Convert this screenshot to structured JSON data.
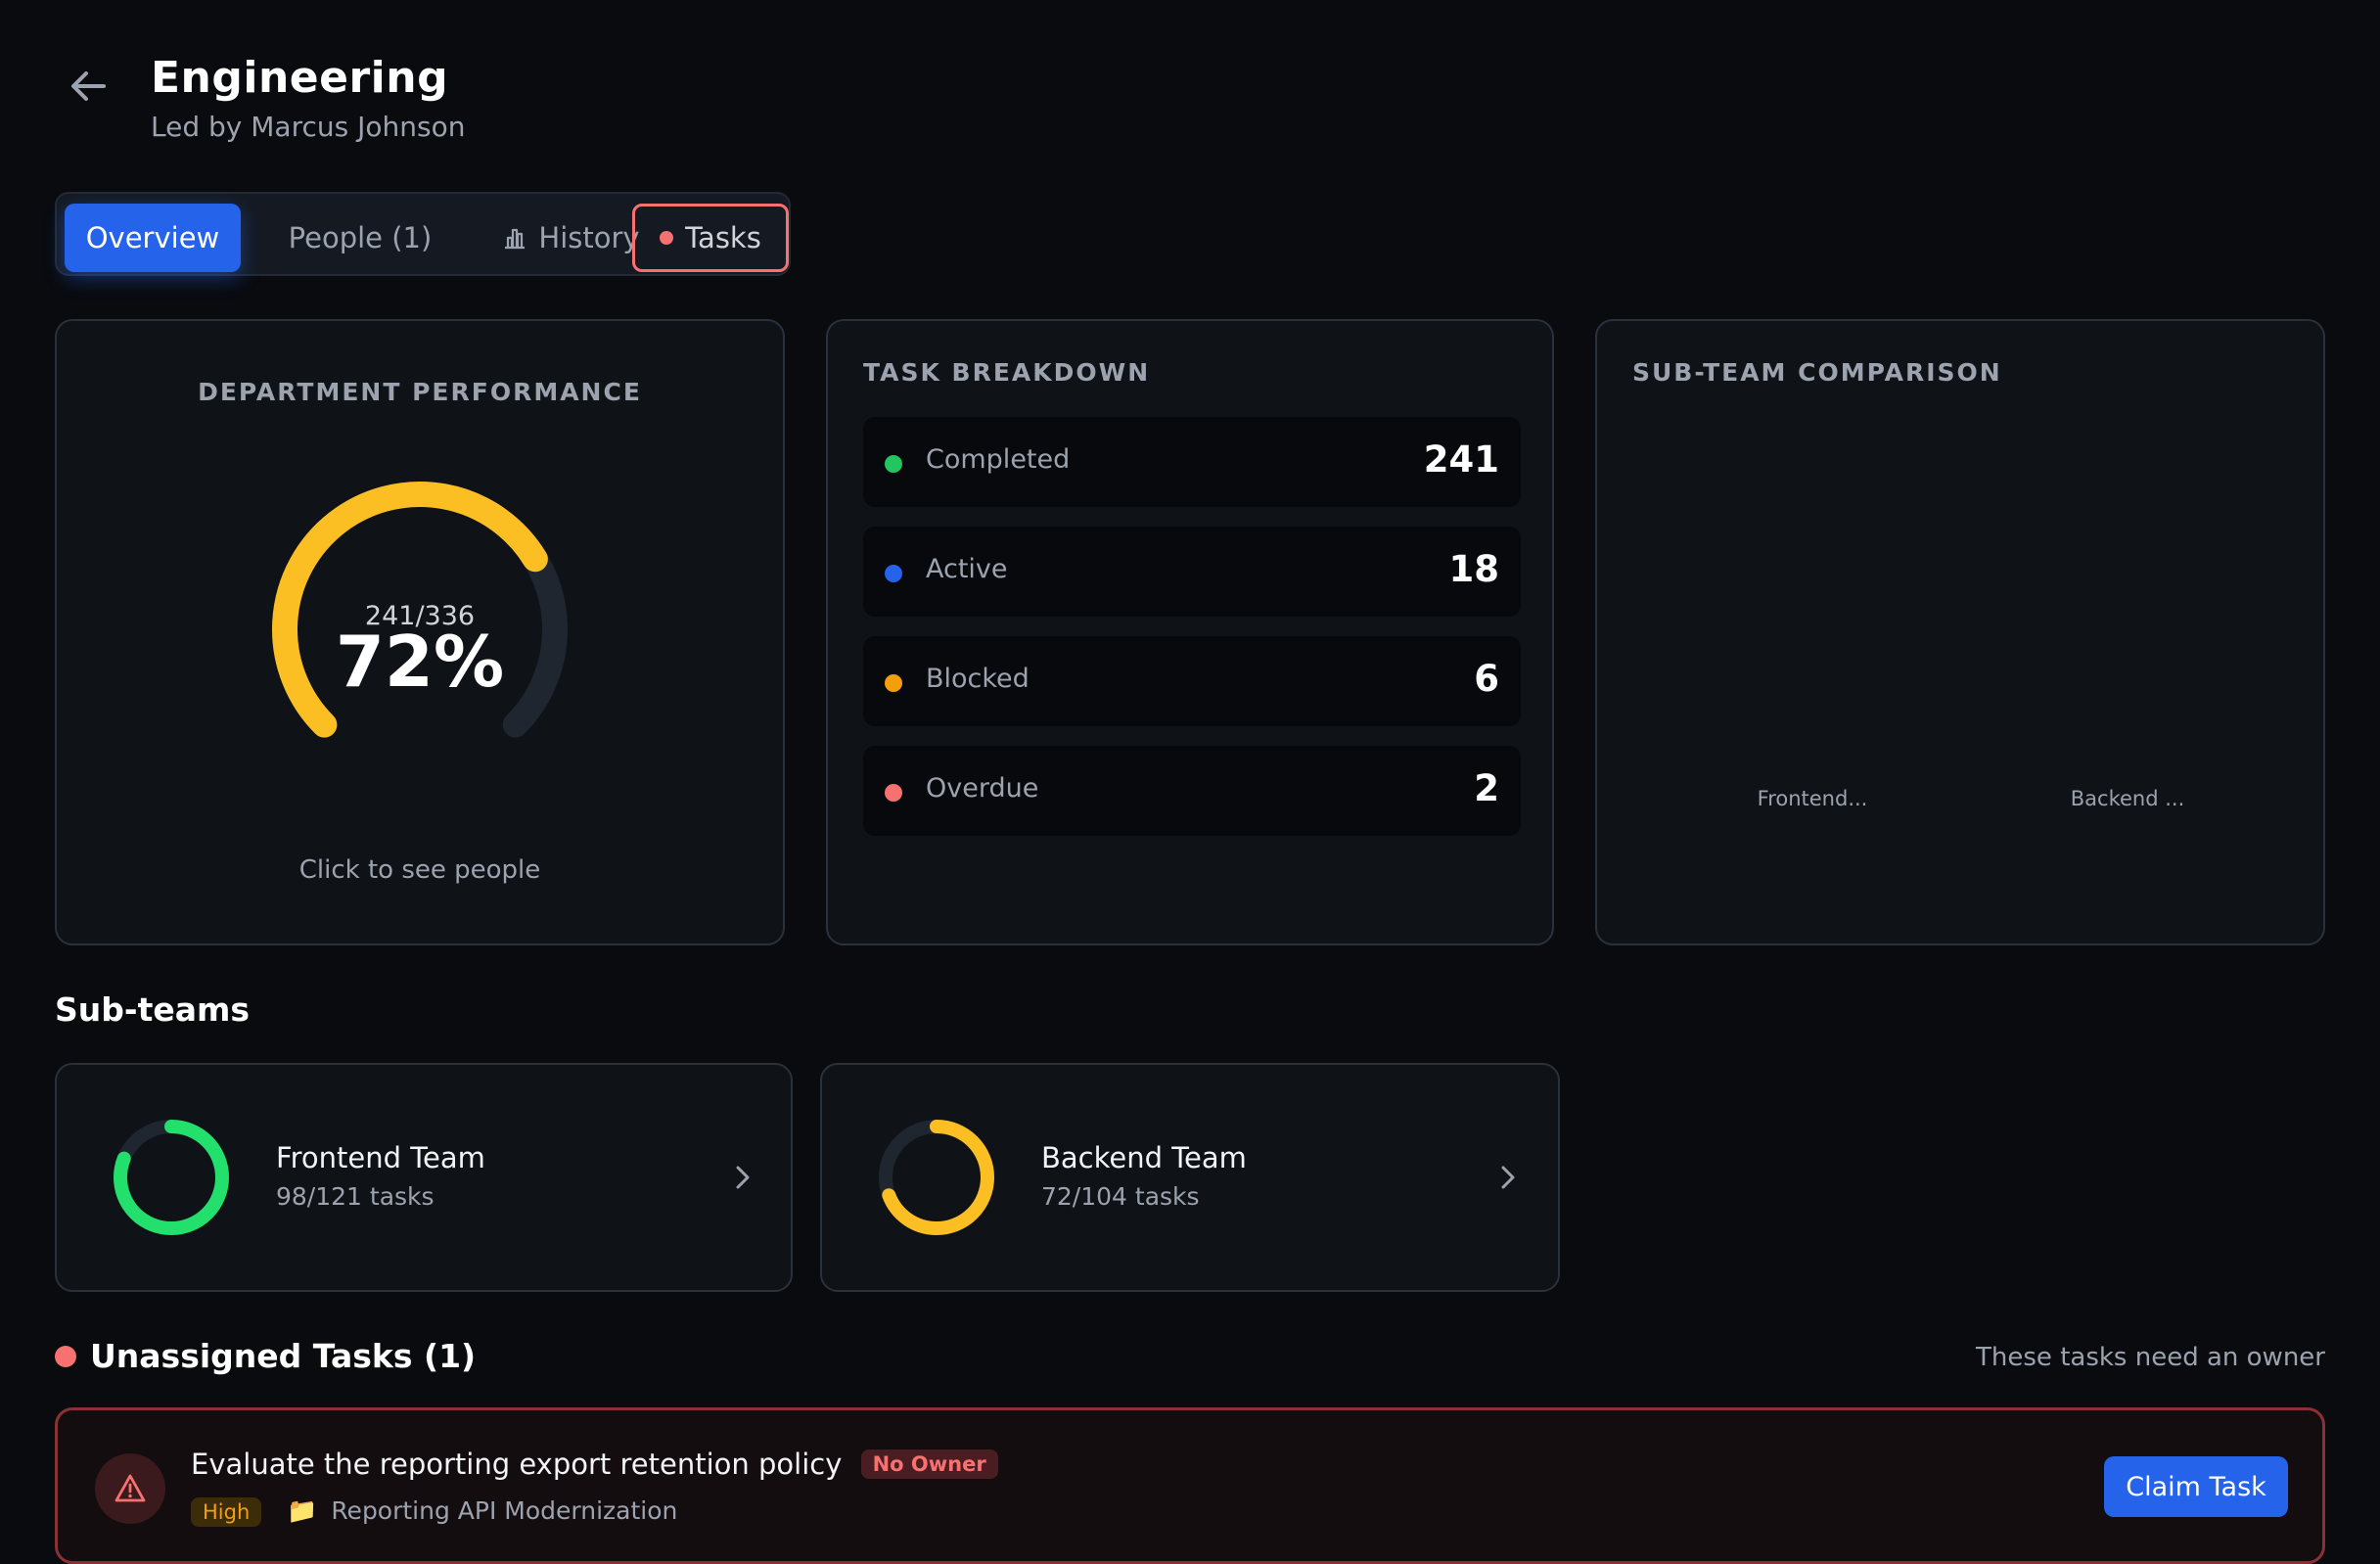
{
  "header": {
    "title": "Engineering",
    "subtitle": "Led by Marcus Johnson"
  },
  "tabs": [
    {
      "label": "Overview"
    },
    {
      "label": "People (1)"
    },
    {
      "label": "History"
    },
    {
      "label": "Tasks"
    }
  ],
  "performance": {
    "title": "DEPARTMENT PERFORMANCE",
    "completed": 241,
    "total": 336,
    "ratio_text": "241/336",
    "percent_text": "72%",
    "percent": 72,
    "color": "#fbbf24",
    "hint": "Click to see people"
  },
  "breakdown": {
    "title": "TASK BREAKDOWN",
    "items": [
      {
        "label": "Completed",
        "value": "241",
        "color": "#22c55e"
      },
      {
        "label": "Active",
        "value": "18",
        "color": "#2563eb"
      },
      {
        "label": "Blocked",
        "value": "6",
        "color": "#f59e0b"
      },
      {
        "label": "Overdue",
        "value": "2",
        "color": "#f87171"
      }
    ]
  },
  "comparison": {
    "title": "SUB-TEAM COMPARISON",
    "labels": [
      "Frontend...",
      "Backend ..."
    ]
  },
  "subteams": {
    "title": "Sub-teams",
    "items": [
      {
        "name": "Frontend Team",
        "tasks": "98/121 tasks",
        "done": 98,
        "total": 121,
        "color": "#22e06b"
      },
      {
        "name": "Backend Team",
        "tasks": "72/104 tasks",
        "done": 72,
        "total": 104,
        "color": "#fbbf24"
      }
    ]
  },
  "unassigned": {
    "title": "Unassigned Tasks (1)",
    "note": "These tasks need an owner",
    "task": {
      "title": "Evaluate the reporting export retention policy",
      "badge": "No Owner",
      "priority": "High",
      "project": "Reporting API Modernization",
      "action": "Claim Task"
    }
  }
}
